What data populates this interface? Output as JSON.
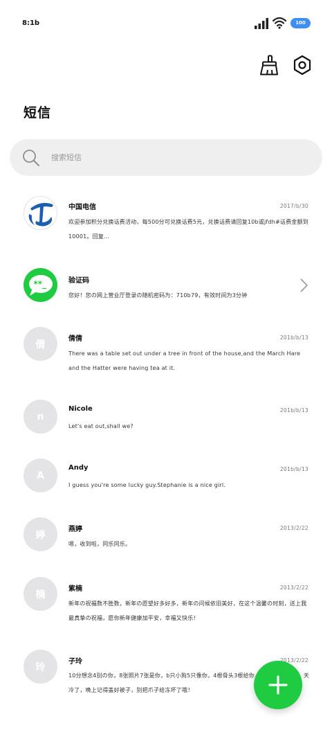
{
  "status_bar": {
    "time": "8:1b",
    "battery": "100"
  },
  "header": {
    "title": "短信"
  },
  "search": {
    "placeholder": "搜索短信"
  },
  "messages": [
    {
      "sender": "中国电信",
      "date": "2017/b/30",
      "preview": "欢迎参加积分兑换话费活动，每500分可兑换话费5元，兑换话费请回复10b或jfdh#话费金额到10001。回复...",
      "avatar_type": "telecom",
      "avatar_text": ""
    },
    {
      "sender": "验证码",
      "date": "",
      "preview": "您好！您の网上营业厅登录の随机密码为：710b79，有效时间为3分钟",
      "avatar_type": "sms",
      "avatar_text": ""
    },
    {
      "sender": "倩倩",
      "date": "201b/b/13",
      "preview": "There was a table set out under a tree in front of the house,and the March Hare and the Hatter were having tea at it.",
      "avatar_type": "letter",
      "avatar_text": "倩"
    },
    {
      "sender": "Nicole",
      "date": "201b/b/13",
      "preview": "Let's eat out,shall we?",
      "avatar_type": "letter",
      "avatar_text": "n"
    },
    {
      "sender": "Andy",
      "date": "201b/b/13",
      "preview": "I guess you're some lucky guy.Stephanie is a nice girl.",
      "avatar_type": "letter",
      "avatar_text": "A"
    },
    {
      "sender": "燕婷",
      "date": "2013/2/22",
      "preview": "嗯，收到啦，同乐同乐。",
      "avatar_type": "letter",
      "avatar_text": "婷"
    },
    {
      "sender": "紫楠",
      "date": "2013/2/22",
      "preview": "新年の祝福数不胜数，新年の愿望好多好多，新年の问候依旧美好，在这个温馨の时刻，送上我最真挚の祝福，愿你新年健康加平安，幸福又快乐！",
      "avatar_type": "letter",
      "avatar_text": "楠"
    },
    {
      "sender": "子玲",
      "date": "2013/2/22",
      "preview": "10分想念4别の你，8张照片7张是你，b只小狗5只像你，4根骨头3根给你，2个字一定是你，天冷了，晚上记得盖好被子，别把爪子给冻坏了哦！",
      "avatar_type": "letter",
      "avatar_text": "玲"
    }
  ],
  "colors": {
    "accent": "#1fcb41",
    "battery": "#3d8ef6",
    "search_bg": "#efefef",
    "avatar_bg": "#e4e4e6",
    "telecom_blue": "#1d5fae"
  },
  "icons": {
    "clean": "broom-icon",
    "settings": "gear-icon",
    "search": "search-icon",
    "compose": "plus-icon"
  }
}
